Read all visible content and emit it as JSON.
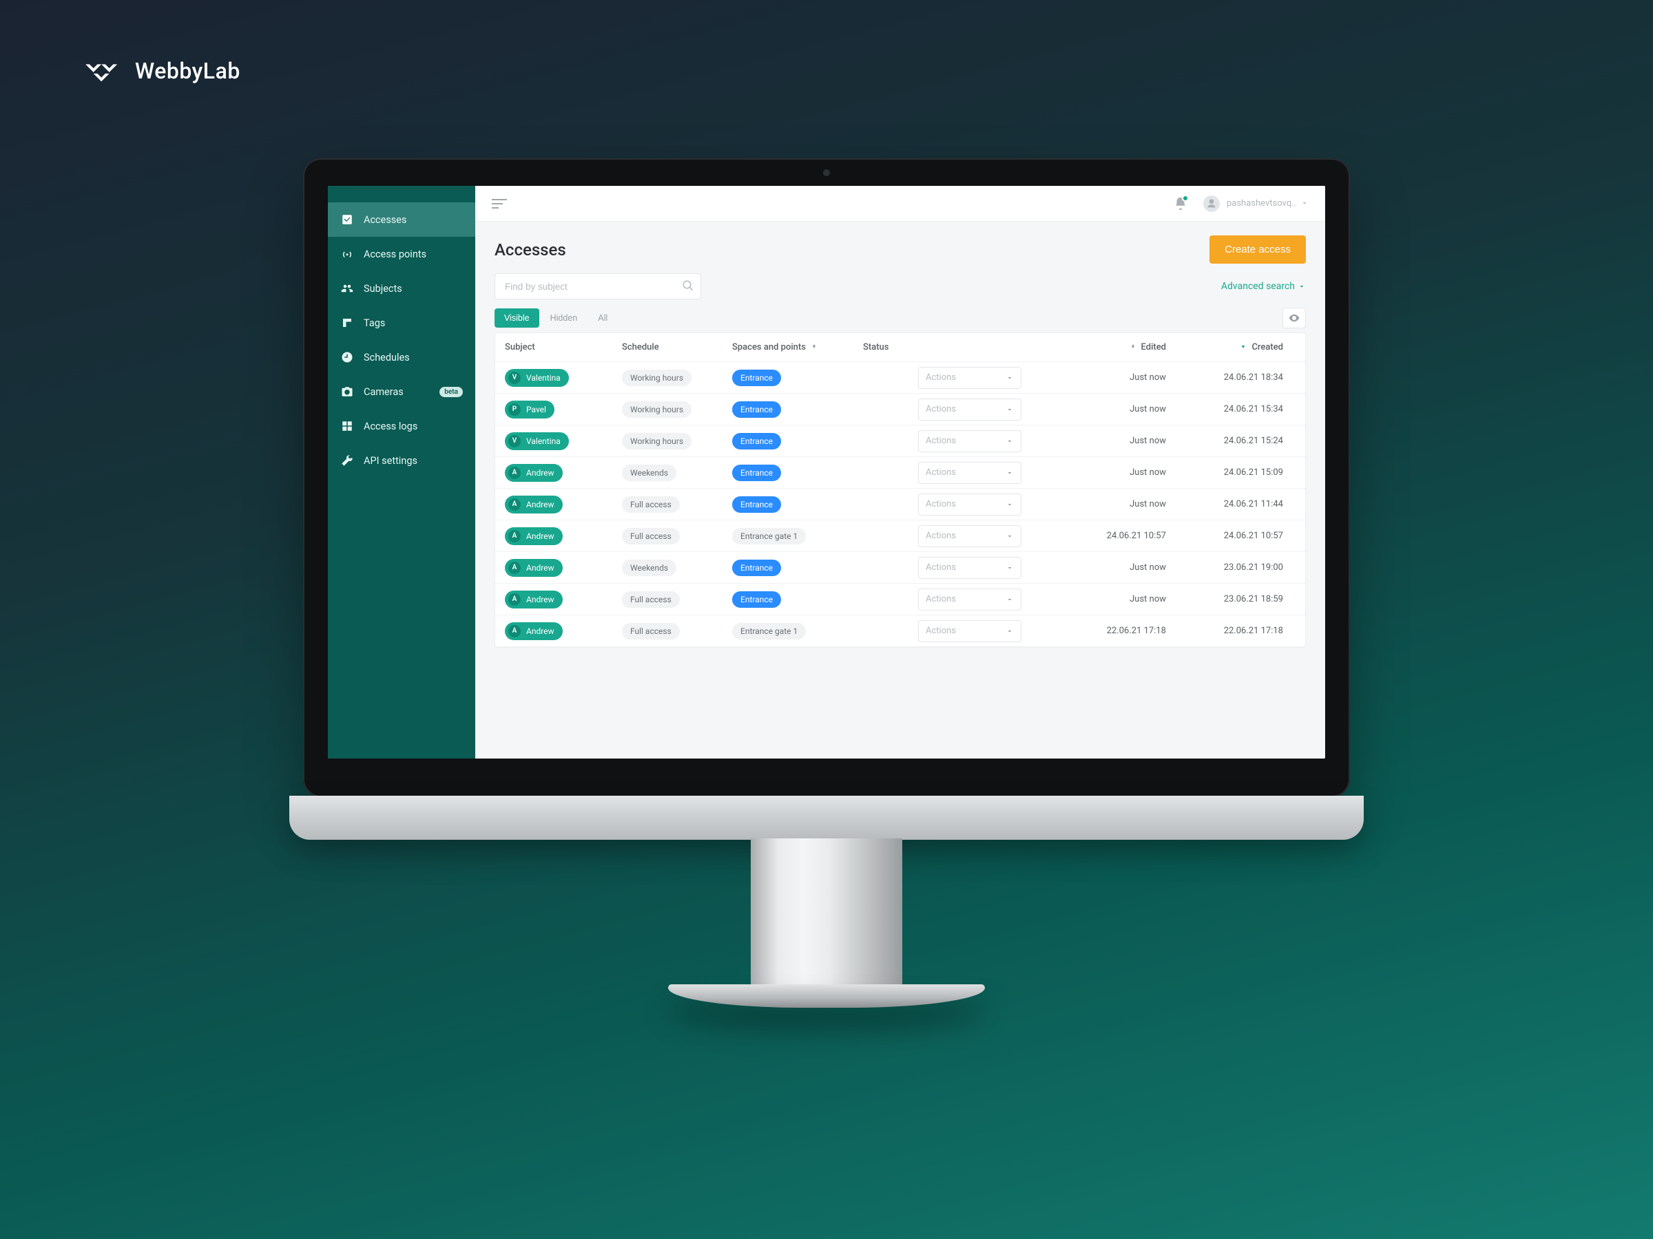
{
  "watermark": {
    "brand": "WebbyLab"
  },
  "topbar": {
    "username": "pashashevtsovq..",
    "notification_badge": true
  },
  "sidebar": {
    "items": [
      {
        "label": "Accesses",
        "icon": "check-square-icon",
        "active": true
      },
      {
        "label": "Access points",
        "icon": "access-point-icon"
      },
      {
        "label": "Subjects",
        "icon": "people-icon"
      },
      {
        "label": "Tags",
        "icon": "tag-icon"
      },
      {
        "label": "Schedules",
        "icon": "clock-icon"
      },
      {
        "label": "Cameras",
        "icon": "camera-icon",
        "badge": "beta"
      },
      {
        "label": "Access logs",
        "icon": "grid-icon"
      },
      {
        "label": "API settings",
        "icon": "wrench-icon"
      }
    ]
  },
  "page": {
    "title": "Accesses",
    "create_button": "Create access",
    "search_placeholder": "Find by subject",
    "advanced_search": "Advanced search",
    "tabs": [
      {
        "label": "Visible",
        "active": true
      },
      {
        "label": "Hidden"
      },
      {
        "label": "All"
      }
    ],
    "columns": {
      "subject": "Subject",
      "schedule": "Schedule",
      "spaces": "Spaces and points",
      "status": "Status",
      "edited": "Edited",
      "created": "Created"
    },
    "actions_placeholder": "Actions",
    "rows": [
      {
        "subject": "Valentina",
        "initial": "V",
        "schedule": "Working hours",
        "space": "Entrance",
        "space_style": "blue",
        "status": true,
        "edited": "Just now",
        "created": "24.06.21 18:34"
      },
      {
        "subject": "Pavel",
        "initial": "P",
        "schedule": "Working hours",
        "space": "Entrance",
        "space_style": "blue",
        "status": true,
        "edited": "Just now",
        "created": "24.06.21 15:34"
      },
      {
        "subject": "Valentina",
        "initial": "V",
        "schedule": "Working hours",
        "space": "Entrance",
        "space_style": "blue",
        "status": true,
        "edited": "Just now",
        "created": "24.06.21 15:24"
      },
      {
        "subject": "Andrew",
        "initial": "A",
        "schedule": "Weekends",
        "space": "Entrance",
        "space_style": "blue",
        "status": true,
        "edited": "Just now",
        "created": "24.06.21 15:09"
      },
      {
        "subject": "Andrew",
        "initial": "A",
        "schedule": "Full access",
        "space": "Entrance",
        "space_style": "blue",
        "status": true,
        "edited": "Just now",
        "created": "24.06.21 11:44"
      },
      {
        "subject": "Andrew",
        "initial": "A",
        "schedule": "Full access",
        "space": "Entrance gate 1",
        "space_style": "gray",
        "status": true,
        "edited": "24.06.21 10:57",
        "created": "24.06.21 10:57"
      },
      {
        "subject": "Andrew",
        "initial": "A",
        "schedule": "Weekends",
        "space": "Entrance",
        "space_style": "blue",
        "status": true,
        "edited": "Just now",
        "created": "23.06.21 19:00"
      },
      {
        "subject": "Andrew",
        "initial": "A",
        "schedule": "Full access",
        "space": "Entrance",
        "space_style": "blue",
        "status": true,
        "edited": "Just now",
        "created": "23.06.21 18:59"
      },
      {
        "subject": "Andrew",
        "initial": "A",
        "schedule": "Full access",
        "space": "Entrance gate 1",
        "space_style": "gray",
        "status": true,
        "edited": "22.06.21 17:18",
        "created": "22.06.21 17:18"
      }
    ]
  }
}
